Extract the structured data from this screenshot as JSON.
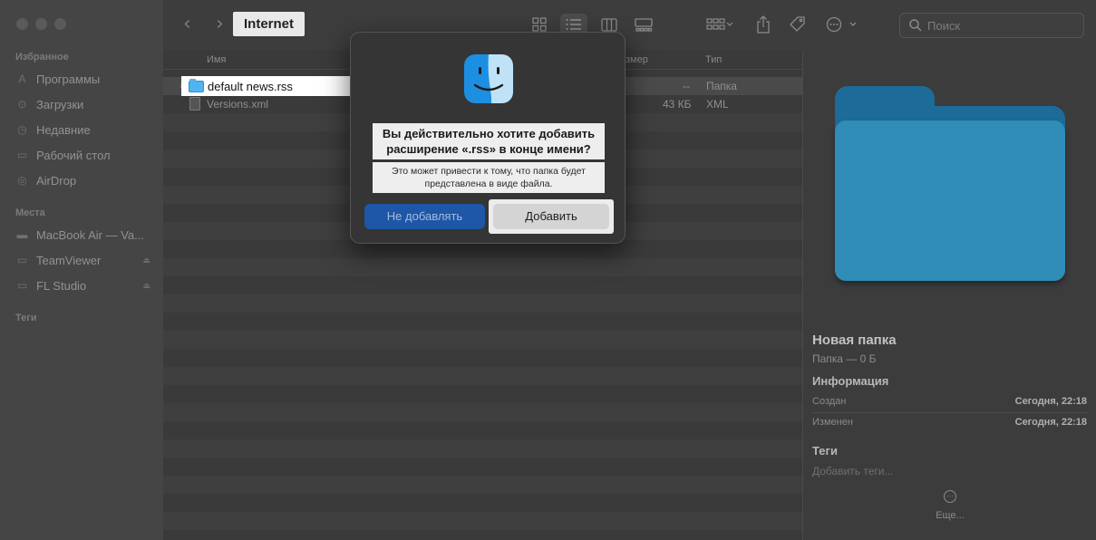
{
  "window": {
    "title": "Internet"
  },
  "sidebar": {
    "favorites_header": "Избранное",
    "favorites": [
      {
        "label": "Программы",
        "icon": "apps-icon"
      },
      {
        "label": "Загрузки",
        "icon": "downloads-icon"
      },
      {
        "label": "Недавние",
        "icon": "recent-icon"
      },
      {
        "label": "Рабочий стол",
        "icon": "desktop-icon"
      },
      {
        "label": "AirDrop",
        "icon": "airdrop-icon"
      }
    ],
    "locations_header": "Места",
    "locations": [
      {
        "label": "MacBook Air — Va...",
        "icon": "laptop-icon"
      },
      {
        "label": "TeamViewer",
        "icon": "disk-icon"
      },
      {
        "label": "FL Studio",
        "icon": "disk-icon"
      }
    ],
    "tags_header": "Теги"
  },
  "toolbar": {
    "search_placeholder": "Поиск"
  },
  "list": {
    "columns": {
      "name": "Имя",
      "size": "змер",
      "kind": "Тип"
    },
    "rows": [
      {
        "name": "default news.rss",
        "size": "--",
        "kind": "Папка",
        "type": "folder"
      },
      {
        "name": "Versions.xml",
        "size": "43 КБ",
        "kind": "XML",
        "type": "file"
      }
    ]
  },
  "preview": {
    "title": "Новая папка",
    "subtitle": "Папка — 0 Б",
    "info_header": "Информация",
    "created_label": "Создан",
    "created_value": "Сегодня, 22:18",
    "modified_label": "Изменен",
    "modified_value": "Сегодня, 22:18",
    "tags_header": "Теги",
    "tags_placeholder": "Добавить теги...",
    "more_label": "Еще..."
  },
  "dialog": {
    "title": "Вы действительно хотите добавить расширение «.rss» в конце имени?",
    "message": "Это может привести к тому, что папка будет представлена в виде файла.",
    "cancel_label": "Не добавлять",
    "confirm_label": "Добавить"
  }
}
